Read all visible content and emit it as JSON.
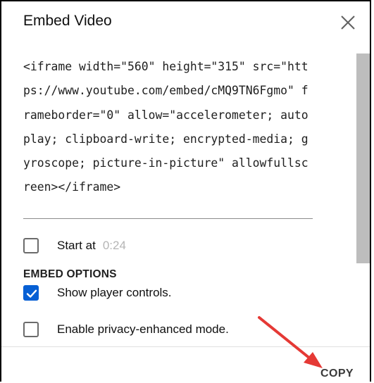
{
  "dialog": {
    "title": "Embed Video",
    "close_icon": "close-icon"
  },
  "embed_code": "<iframe width=\"560\" height=\"315\" src=\"https://www.youtube.com/embed/cMQ9TN6Fgmo\" frameborder=\"0\" allow=\"accelerometer; autoplay; clipboard-write; encrypted-media; gyroscope; picture-in-picture\" allowfullscreen></iframe>",
  "start_at": {
    "label": "Start at",
    "time": "0:24",
    "checked": false
  },
  "embed_options": {
    "heading": "EMBED OPTIONS",
    "show_player_controls": {
      "label": "Show player controls.",
      "checked": true
    },
    "privacy_enhanced": {
      "label": "Enable privacy-enhanced mode.",
      "checked": false
    }
  },
  "footer": {
    "copy_label": "COPY"
  },
  "colors": {
    "accent": "#065fd4",
    "annotation_arrow": "#e53935"
  }
}
